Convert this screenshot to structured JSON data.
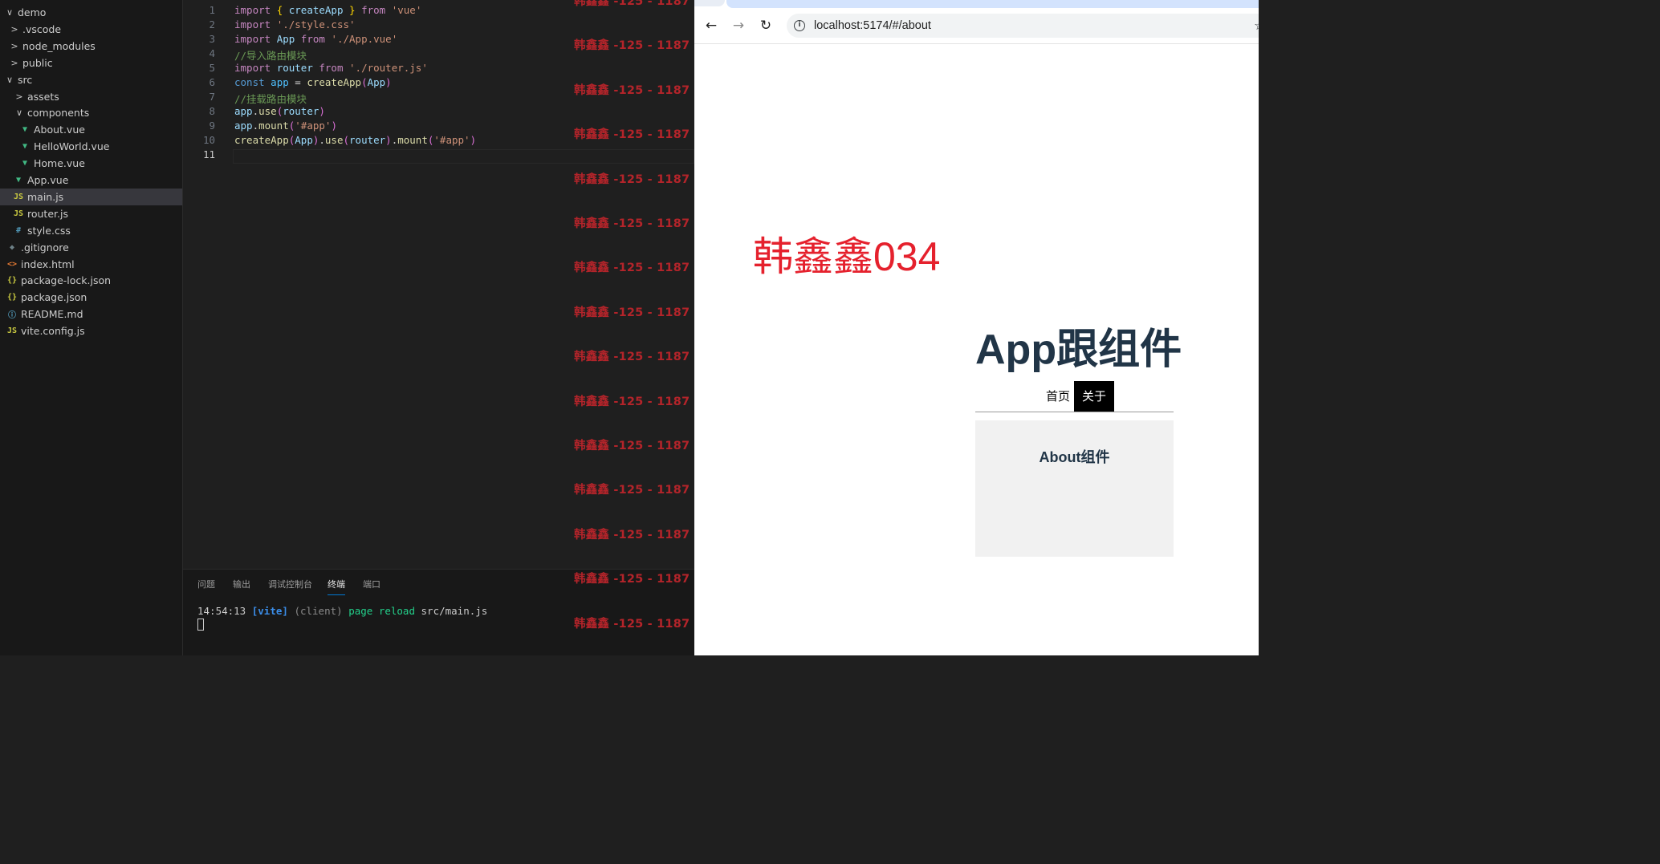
{
  "explorer": {
    "items": [
      {
        "label": "demo",
        "chevron": "∨",
        "icon": ""
      },
      {
        "label": ".vscode",
        "chevron": ">",
        "icon": ""
      },
      {
        "label": "node_modules",
        "chevron": ">",
        "icon": ""
      },
      {
        "label": "public",
        "chevron": ">",
        "icon": ""
      },
      {
        "label": "src",
        "chevron": "∨",
        "icon": ""
      },
      {
        "label": "assets",
        "chevron": ">",
        "icon": ""
      },
      {
        "label": "components",
        "chevron": "∨",
        "icon": ""
      },
      {
        "label": "About.vue",
        "chevron": "",
        "icon": "vue-icon"
      },
      {
        "label": "HelloWorld.vue",
        "chevron": "",
        "icon": "vue-icon"
      },
      {
        "label": "Home.vue",
        "chevron": "",
        "icon": "vue-icon"
      },
      {
        "label": "App.vue",
        "chevron": "",
        "icon": "vue-icon"
      },
      {
        "label": "main.js",
        "chevron": "",
        "icon": "js-icon"
      },
      {
        "label": "router.js",
        "chevron": "",
        "icon": "js-icon"
      },
      {
        "label": "style.css",
        "chevron": "",
        "icon": "css-icon"
      },
      {
        "label": ".gitignore",
        "chevron": "",
        "icon": "git-icon"
      },
      {
        "label": "index.html",
        "chevron": "",
        "icon": "html-icon"
      },
      {
        "label": "package-lock.json",
        "chevron": "",
        "icon": "json-icon"
      },
      {
        "label": "package.json",
        "chevron": "",
        "icon": "json-icon"
      },
      {
        "label": "README.md",
        "chevron": "",
        "icon": "info-icon"
      },
      {
        "label": "vite.config.js",
        "chevron": "",
        "icon": "js-icon"
      }
    ],
    "selected": "main.js"
  },
  "editor": {
    "line_numbers": [
      "1",
      "2",
      "3",
      "4",
      "5",
      "6",
      "7",
      "8",
      "9",
      "10",
      "11"
    ],
    "active_line": "11",
    "lines": [
      [
        {
          "t": "import",
          "c": "kw"
        },
        {
          "t": " ",
          "c": "plain"
        },
        {
          "t": "{",
          "c": "brace"
        },
        {
          "t": " ",
          "c": "plain"
        },
        {
          "t": "createApp",
          "c": "id"
        },
        {
          "t": " ",
          "c": "plain"
        },
        {
          "t": "}",
          "c": "brace"
        },
        {
          "t": " ",
          "c": "plain"
        },
        {
          "t": "from",
          "c": "kw"
        },
        {
          "t": " ",
          "c": "plain"
        },
        {
          "t": "'vue'",
          "c": "str"
        }
      ],
      [
        {
          "t": "import",
          "c": "kw"
        },
        {
          "t": " ",
          "c": "plain"
        },
        {
          "t": "'./style.css'",
          "c": "str"
        }
      ],
      [
        {
          "t": "import",
          "c": "kw"
        },
        {
          "t": " ",
          "c": "plain"
        },
        {
          "t": "App",
          "c": "id"
        },
        {
          "t": " ",
          "c": "plain"
        },
        {
          "t": "from",
          "c": "kw"
        },
        {
          "t": " ",
          "c": "plain"
        },
        {
          "t": "'./App.vue'",
          "c": "str"
        }
      ],
      [
        {
          "t": "//导入路由模块",
          "c": "cm"
        }
      ],
      [
        {
          "t": "import",
          "c": "kw"
        },
        {
          "t": " ",
          "c": "plain"
        },
        {
          "t": "router",
          "c": "id"
        },
        {
          "t": " ",
          "c": "plain"
        },
        {
          "t": "from",
          "c": "kw"
        },
        {
          "t": " ",
          "c": "plain"
        },
        {
          "t": "'./router.js'",
          "c": "str"
        }
      ],
      [
        {
          "t": "const",
          "c": "const"
        },
        {
          "t": " ",
          "c": "plain"
        },
        {
          "t": "app",
          "c": "constv"
        },
        {
          "t": " = ",
          "c": "plain"
        },
        {
          "t": "createApp",
          "c": "fn"
        },
        {
          "t": "(",
          "c": "paren"
        },
        {
          "t": "App",
          "c": "id"
        },
        {
          "t": ")",
          "c": "paren"
        }
      ],
      [
        {
          "t": "//挂载路由模块",
          "c": "cm"
        }
      ],
      [
        {
          "t": "app",
          "c": "id"
        },
        {
          "t": ".",
          "c": "plain"
        },
        {
          "t": "use",
          "c": "fn"
        },
        {
          "t": "(",
          "c": "paren"
        },
        {
          "t": "router",
          "c": "id"
        },
        {
          "t": ")",
          "c": "paren"
        }
      ],
      [
        {
          "t": "app",
          "c": "id"
        },
        {
          "t": ".",
          "c": "plain"
        },
        {
          "t": "mount",
          "c": "fn"
        },
        {
          "t": "(",
          "c": "paren"
        },
        {
          "t": "'#app'",
          "c": "str"
        },
        {
          "t": ")",
          "c": "paren"
        }
      ],
      [
        {
          "t": "createApp",
          "c": "fn"
        },
        {
          "t": "(",
          "c": "paren"
        },
        {
          "t": "App",
          "c": "id"
        },
        {
          "t": ")",
          "c": "paren"
        },
        {
          "t": ".",
          "c": "plain"
        },
        {
          "t": "use",
          "c": "fn"
        },
        {
          "t": "(",
          "c": "paren"
        },
        {
          "t": "router",
          "c": "id"
        },
        {
          "t": ")",
          "c": "paren"
        },
        {
          "t": ".",
          "c": "plain"
        },
        {
          "t": "mount",
          "c": "fn"
        },
        {
          "t": "(",
          "c": "paren"
        },
        {
          "t": "'#app'",
          "c": "str"
        },
        {
          "t": ")",
          "c": "paren"
        }
      ],
      []
    ]
  },
  "panel": {
    "tabs": [
      "问题",
      "输出",
      "调试控制台",
      "终端",
      "端口"
    ],
    "active_tab": "终端",
    "terminal": {
      "time": "14:54:13",
      "tag": "[vite]",
      "client": "(client)",
      "action": "page reload",
      "file": "src/main.js"
    }
  },
  "watermark": {
    "text": "韩鑫鑫 -125 - 1187",
    "count": 15
  },
  "browser": {
    "url": "localhost:5174/#/about",
    "back_glyph": "←",
    "forward_glyph": "→",
    "reload_glyph": "↻",
    "info_glyph": "i",
    "star_glyph": "☆",
    "page": {
      "red_heading": "韩鑫鑫034",
      "title": "App跟组件",
      "nav": {
        "home": "首页",
        "about": "关于"
      },
      "active_nav": "about",
      "about_heading": "About组件"
    }
  },
  "colors": {
    "editor_bg": "#1f1f1f",
    "sidebar_bg": "#181818",
    "watermark": "#b3242a",
    "red_heading": "#e5212d",
    "vue_heading": "#213547",
    "active_nav_bg": "#000000"
  }
}
